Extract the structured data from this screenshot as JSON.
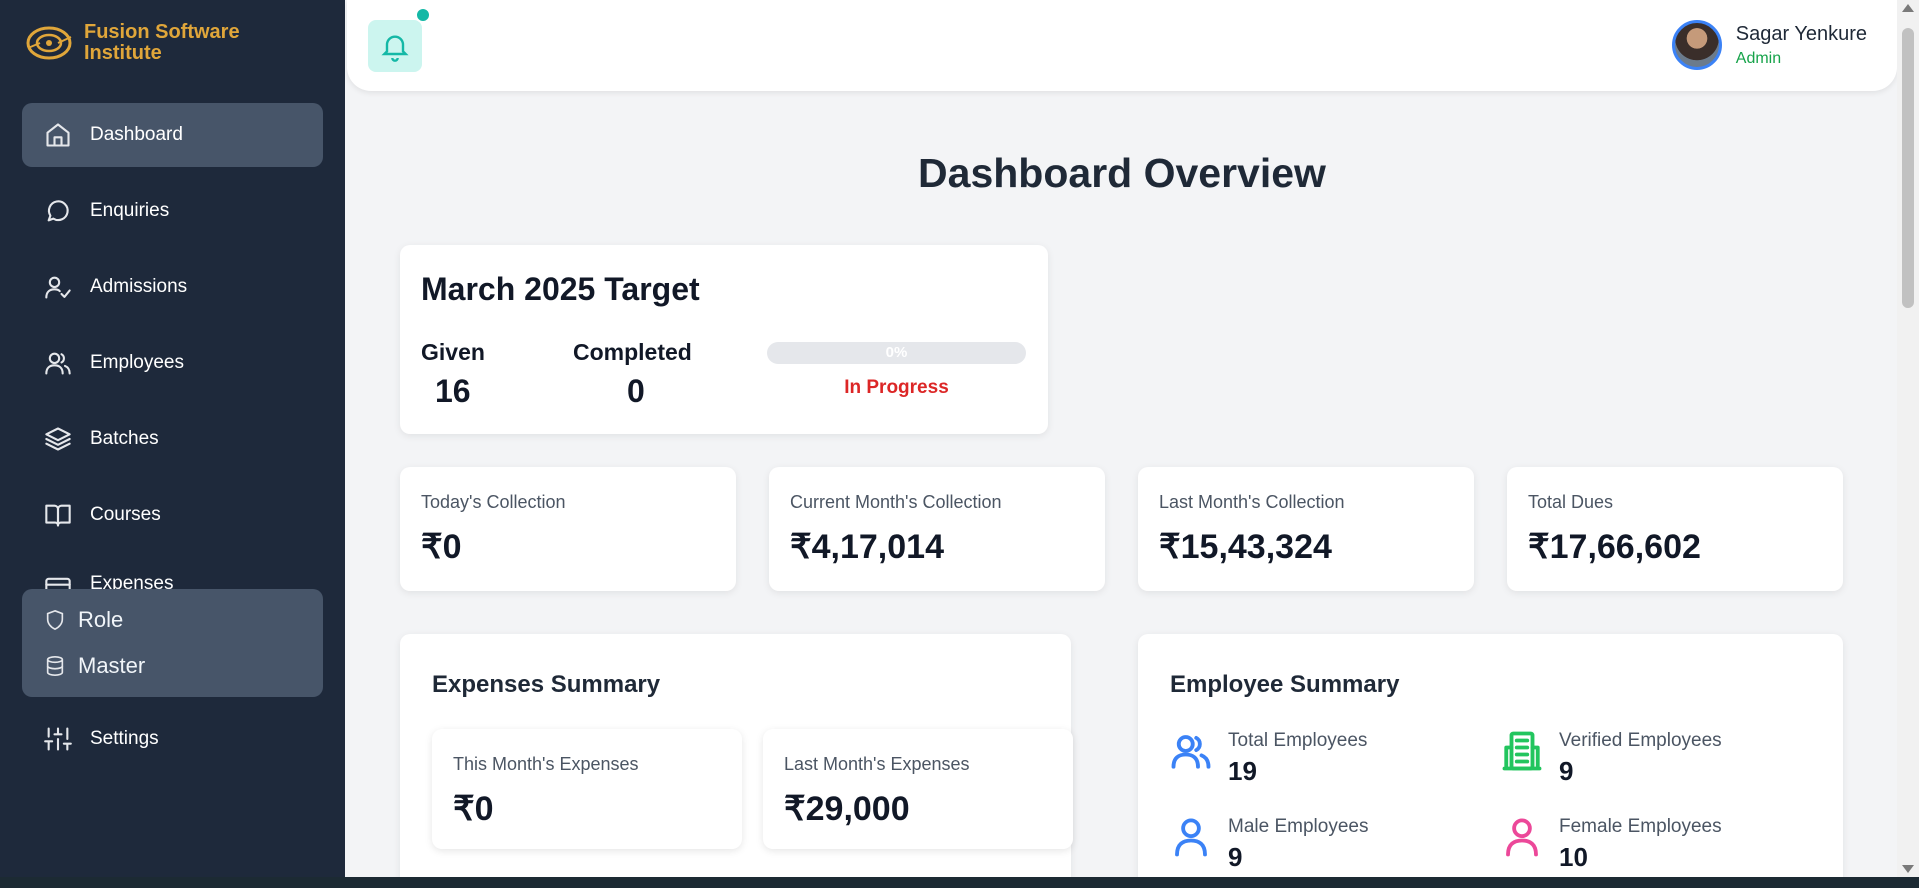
{
  "brand": {
    "name": "Fusion Software Institute"
  },
  "sidebar": {
    "items": [
      {
        "label": "Dashboard",
        "icon": "home-icon",
        "active": true
      },
      {
        "label": "Enquiries",
        "icon": "chat-icon"
      },
      {
        "label": "Admissions",
        "icon": "user-check-icon"
      },
      {
        "label": "Employees",
        "icon": "users-icon"
      },
      {
        "label": "Batches",
        "icon": "layers-icon"
      },
      {
        "label": "Courses",
        "icon": "book-icon"
      },
      {
        "label": "Expenses",
        "icon": "wallet-icon"
      },
      {
        "label": "Settings",
        "icon": "sliders-icon"
      }
    ],
    "submenu": [
      {
        "label": "Role",
        "icon": "shield-icon"
      },
      {
        "label": "Master",
        "icon": "database-icon"
      }
    ]
  },
  "topbar": {
    "user": {
      "name": "Sagar Yenkure",
      "role": "Admin"
    }
  },
  "page": {
    "title": "Dashboard Overview"
  },
  "target": {
    "title": "March 2025 Target",
    "given_label": "Given",
    "given_value": "16",
    "completed_label": "Completed",
    "completed_value": "0",
    "progress_percent": 0,
    "progress_text": "0%",
    "status": "In Progress"
  },
  "collections": [
    {
      "label": "Today's Collection",
      "value": "₹0"
    },
    {
      "label": "Current Month's Collection",
      "value": "₹4,17,014"
    },
    {
      "label": "Last Month's Collection",
      "value": "₹15,43,324"
    },
    {
      "label": "Total Dues",
      "value": "₹17,66,602"
    }
  ],
  "expenses_summary": {
    "title": "Expenses Summary",
    "items": [
      {
        "label": "This Month's Expenses",
        "value": "₹0"
      },
      {
        "label": "Last Month's Expenses",
        "value": "₹29,000"
      }
    ]
  },
  "employee_summary": {
    "title": "Employee Summary",
    "items": [
      {
        "label": "Total Employees",
        "value": "19",
        "icon": "users-icon",
        "color": "#3b82f6"
      },
      {
        "label": "Verified Employees",
        "value": "9",
        "icon": "building-icon",
        "color": "#22c55e"
      },
      {
        "label": "Male Employees",
        "value": "9",
        "icon": "user-icon",
        "color": "#3b82f6"
      },
      {
        "label": "Female Employees",
        "value": "10",
        "icon": "user-icon",
        "color": "#ec4899"
      }
    ]
  },
  "colors": {
    "sidebar_bg": "#1e293b",
    "active_bg": "#475569",
    "brand": "#e0a63a",
    "accent_teal": "#14b8a6",
    "status_red": "#dc2626",
    "admin_green": "#16a34a"
  }
}
